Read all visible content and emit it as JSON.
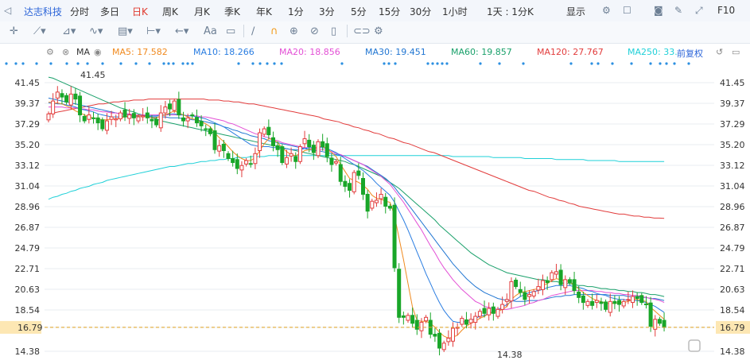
{
  "toolbar": {
    "stock_name": "达志科技",
    "periods": [
      "分时",
      "多日",
      "日K",
      "周K",
      "月K",
      "季K",
      "年K",
      "1分",
      "3分",
      "5分",
      "15分",
      "30分",
      "1小时",
      "1天 : 1分K"
    ],
    "active_period": "日K",
    "display_label": "显示",
    "right_label": "F10"
  },
  "drawing_tools": {
    "text_tool": "Aa",
    "icons": [
      "crosshair-icon",
      "line-tool-icon",
      "channel-tool-icon",
      "wave-tool-icon",
      "fib-tool-icon",
      "measure-tool-icon",
      "undo-icon",
      "text-tool-icon",
      "comment-icon",
      "pen-icon",
      "magnet-icon",
      "lock-icon",
      "hide-icon",
      "delete-icon",
      "link-icon",
      "settings-icon"
    ]
  },
  "indicators": {
    "label": "MA",
    "ma5": "MA5: 17.582",
    "ma10": "MA10: 18.266",
    "ma20": "MA20: 18.856",
    "ma30": "MA30: 19.451",
    "ma60": "MA60: 19.857",
    "ma120": "MA120: 27.767",
    "ma250": "MA250: 33.",
    "adjust": "前复权",
    "colors": {
      "ma5": "#f08a1f",
      "ma10": "#2a7de1",
      "ma20": "#e34fd5",
      "ma30": "#2176d2",
      "ma60": "#19a06a",
      "ma120": "#e23c3c",
      "ma250": "#1fd0d8"
    }
  },
  "chart_data": {
    "type": "candlestick",
    "y_ticks": [
      "41.45",
      "39.37",
      "37.29",
      "35.20",
      "33.12",
      "31.04",
      "28.96",
      "26.87",
      "24.79",
      "22.71",
      "20.63",
      "18.54",
      "16.79",
      "14.38"
    ],
    "ylim": [
      14.38,
      41.45
    ],
    "current_price": "16.79",
    "high_label": "41.45",
    "low_label": "14.38",
    "up_color": "#e23c3c",
    "down_color": "#19a629",
    "closes": [
      38.3,
      39.6,
      40.5,
      40.0,
      39.5,
      40.3,
      39.8,
      38.2,
      37.6,
      38.2,
      37.9,
      37.4,
      36.8,
      37.6,
      38.0,
      37.8,
      38.4,
      38.0,
      38.2,
      37.9,
      38.0,
      38.1,
      37.9,
      37.6,
      37.2,
      38.4,
      39.0,
      38.8,
      39.6,
      38.2,
      37.6,
      37.9,
      38.1,
      37.4,
      37.1,
      36.8,
      36.3,
      34.7,
      35.1,
      34.6,
      33.8,
      33.4,
      32.8,
      33.1,
      33.6,
      33.3,
      34.3,
      36.4,
      36.8,
      36.2,
      35.1,
      34.7,
      33.4,
      33.9,
      34.3,
      33.5,
      35.0,
      35.8,
      35.0,
      34.4,
      35.5,
      35.0,
      34.0,
      33.2,
      33.5,
      31.5,
      31.0,
      30.6,
      32.4,
      32.1,
      30.2,
      28.5,
      29.5,
      29.6,
      30.2,
      29.0,
      28.8,
      22.8,
      17.8,
      17.8,
      18.0,
      17.2,
      16.6,
      17.3,
      17.8,
      16.1,
      15.9,
      14.7,
      15.2,
      15.7,
      16.7,
      16.8,
      17.7,
      17.1,
      17.6,
      17.9,
      18.4,
      18.2,
      18.7,
      18.2,
      18.6,
      19.1,
      19.6,
      21.4,
      20.9,
      20.3,
      19.6,
      20.1,
      20.4,
      20.9,
      21.5,
      21.3,
      22.3,
      22.4,
      21.1,
      21.6,
      21.3,
      20.5,
      19.8,
      19.3,
      19.4,
      19.0,
      19.5,
      19.2,
      18.6,
      19.4,
      19.2,
      19.1,
      19.4,
      19.6,
      19.9,
      19.7,
      19.3,
      19.1,
      16.9,
      17.6,
      17.2,
      16.79
    ],
    "ma5": [
      39.5,
      39.4,
      39.4,
      39.3,
      39.1,
      38.9,
      38.6,
      38.4,
      38.2,
      38.0,
      37.9,
      37.8,
      37.7,
      37.7,
      37.8,
      37.8,
      37.9,
      38.0,
      38.1,
      38.1,
      38.1,
      38.1,
      38.0,
      37.9,
      37.9,
      38.1,
      38.2,
      38.4,
      38.6,
      38.4,
      38.2,
      38.0,
      37.8,
      37.7,
      37.5,
      37.3,
      37.0,
      36.4,
      35.9,
      35.5,
      35.0,
      34.5,
      34.1,
      33.8,
      33.6,
      33.6,
      33.9,
      34.6,
      35.3,
      35.8,
      35.7,
      35.4,
      34.9,
      34.5,
      34.2,
      34.1,
      34.3,
      34.6,
      34.7,
      34.8,
      35.0,
      35.0,
      34.8,
      34.4,
      34.0,
      33.2,
      32.5,
      31.8,
      31.6,
      31.4,
      31.1,
      30.7,
      30.1,
      29.8,
      29.7,
      29.5,
      29.4,
      28.0,
      25.8,
      23.6,
      21.2,
      18.8,
      17.5,
      17.4,
      17.4,
      17.2,
      16.8,
      16.3,
      15.9,
      15.7,
      15.8,
      16.0,
      16.5,
      16.9,
      17.2,
      17.4,
      17.7,
      17.9,
      18.2,
      18.3,
      18.4,
      18.6,
      18.9,
      19.6,
      20.0,
      20.3,
      20.4,
      20.5,
      20.6,
      20.7,
      21.0,
      21.2,
      21.5,
      21.7,
      21.6,
      21.5,
      21.4,
      21.0,
      20.7,
      20.3,
      20.0,
      19.7,
      19.5,
      19.4,
      19.2,
      19.2,
      19.2,
      19.3,
      19.3,
      19.4,
      19.6,
      19.6,
      19.5,
      19.4,
      18.8,
      18.4,
      18.0,
      17.6
    ],
    "ma10": [
      39.4,
      39.4,
      39.3,
      39.3,
      39.2,
      39.1,
      39.0,
      38.8,
      38.7,
      38.6,
      38.5,
      38.3,
      38.2,
      38.1,
      38.0,
      38.0,
      38.0,
      38.0,
      38.0,
      38.0,
      38.1,
      38.1,
      38.1,
      38.1,
      38.1,
      38.2,
      38.2,
      38.3,
      38.3,
      38.2,
      38.2,
      38.1,
      38.1,
      38.0,
      37.9,
      37.8,
      37.6,
      37.4,
      37.2,
      37.0,
      36.7,
      36.4,
      36.1,
      35.8,
      35.5,
      35.2,
      35.1,
      35.0,
      35.0,
      35.0,
      34.9,
      34.9,
      34.8,
      34.8,
      34.7,
      34.7,
      34.7,
      34.8,
      34.9,
      34.9,
      34.9,
      34.9,
      34.8,
      34.6,
      34.4,
      34.1,
      33.8,
      33.5,
      33.2,
      32.9,
      32.6,
      32.2,
      31.8,
      31.3,
      30.9,
      30.5,
      30.1,
      29.4,
      28.5,
      27.6,
      26.6,
      25.5,
      24.4,
      23.3,
      22.2,
      21.2,
      20.2,
      19.3,
      18.5,
      17.9,
      17.4,
      17.3,
      17.3,
      17.4,
      17.5,
      17.7,
      17.9,
      18.0,
      18.2,
      18.4,
      18.6,
      18.8,
      19.1,
      19.4,
      19.6,
      19.9,
      20.1,
      20.3,
      20.4,
      20.5,
      20.6,
      20.8,
      20.9,
      21.0,
      21.0,
      21.0,
      21.0,
      20.9,
      20.8,
      20.7,
      20.5,
      20.4,
      20.2,
      20.1,
      20.0,
      19.8,
      19.7,
      19.6,
      19.6,
      19.5,
      19.5,
      19.5,
      19.4,
      19.3,
      19.1,
      18.9,
      18.6,
      18.3
    ],
    "ma20": [
      39.0,
      39.0,
      39.0,
      39.0,
      38.9,
      38.9,
      38.9,
      38.8,
      38.8,
      38.7,
      38.7,
      38.6,
      38.5,
      38.5,
      38.4,
      38.4,
      38.3,
      38.3,
      38.3,
      38.2,
      38.2,
      38.2,
      38.2,
      38.2,
      38.2,
      38.2,
      38.2,
      38.2,
      38.2,
      38.2,
      38.2,
      38.1,
      38.1,
      38.1,
      38.0,
      38.0,
      37.9,
      37.8,
      37.7,
      37.6,
      37.4,
      37.3,
      37.1,
      36.9,
      36.7,
      36.5,
      36.3,
      36.2,
      36.0,
      35.9,
      35.7,
      35.6,
      35.4,
      35.3,
      35.2,
      35.1,
      35.0,
      34.9,
      34.9,
      34.8,
      34.7,
      34.7,
      34.6,
      34.5,
      34.3,
      34.2,
      34.0,
      33.8,
      33.6,
      33.4,
      33.2,
      32.9,
      32.6,
      32.3,
      32.0,
      31.6,
      31.2,
      30.6,
      30.0,
      29.4,
      28.7,
      28.0,
      27.3,
      26.6,
      25.8,
      25.0,
      24.3,
      23.5,
      22.8,
      22.2,
      21.6,
      21.1,
      20.6,
      20.2,
      19.8,
      19.4,
      19.2,
      18.9,
      18.8,
      18.7,
      18.6,
      18.6,
      18.6,
      18.7,
      18.8,
      18.9,
      19.0,
      19.2,
      19.3,
      19.5,
      19.6,
      19.8,
      20.0,
      20.1,
      20.2,
      20.3,
      20.4,
      20.5,
      20.5,
      20.5,
      20.5,
      20.5,
      20.4,
      20.4,
      20.3,
      20.3,
      20.2,
      20.2,
      20.1,
      20.1,
      20.0,
      20.0,
      19.9,
      19.8,
      19.7,
      19.6,
      19.5,
      19.3
    ],
    "ma30": [
      39.9,
      39.8,
      39.7,
      39.6,
      39.5,
      39.4,
      39.3,
      39.2,
      39.1,
      39.0,
      38.9,
      38.8,
      38.7,
      38.6,
      38.5,
      38.4,
      38.3,
      38.3,
      38.2,
      38.2,
      38.1,
      38.1,
      38.1,
      38.0,
      38.0,
      38.0,
      38.0,
      37.9,
      37.9,
      37.9,
      37.8,
      37.8,
      37.7,
      37.7,
      37.6,
      37.5,
      37.4,
      37.3,
      37.2,
      37.0,
      36.9,
      36.7,
      36.6,
      36.4,
      36.3,
      36.1,
      36.0,
      35.9,
      35.8,
      35.6,
      35.5,
      35.4,
      35.3,
      35.2,
      35.1,
      35.0,
      34.9,
      34.8,
      34.7,
      34.6,
      34.6,
      34.5,
      34.4,
      34.3,
      34.2,
      34.1,
      34.0,
      33.8,
      33.6,
      33.4,
      33.2,
      33.0,
      32.7,
      32.4,
      32.1,
      31.8,
      31.4,
      30.9,
      30.3,
      29.8,
      29.2,
      28.6,
      28.0,
      27.4,
      26.8,
      26.2,
      25.6,
      25.0,
      24.4,
      23.8,
      23.2,
      22.7,
      22.2,
      21.7,
      21.3,
      20.9,
      20.6,
      20.3,
      20.1,
      19.9,
      19.7,
      19.6,
      19.5,
      19.5,
      19.4,
      19.4,
      19.4,
      19.5,
      19.5,
      19.5,
      19.6,
      19.7,
      19.8,
      19.9,
      19.9,
      20.0,
      20.0,
      20.1,
      20.1,
      20.1,
      20.1,
      20.1,
      20.1,
      20.1,
      20.1,
      20.0,
      20.0,
      20.0,
      20.0,
      19.9,
      19.9,
      19.9,
      19.8,
      19.8,
      19.7,
      19.7,
      19.6,
      19.5,
      19.5,
      19.45
    ],
    "ma60": [
      42.0,
      41.9,
      41.7,
      41.5,
      41.3,
      41.1,
      40.9,
      40.7,
      40.5,
      40.3,
      40.1,
      39.9,
      39.7,
      39.5,
      39.3,
      39.1,
      38.9,
      38.8,
      38.6,
      38.5,
      38.3,
      38.2,
      38.0,
      37.9,
      37.8,
      37.6,
      37.5,
      37.4,
      37.3,
      37.2,
      37.1,
      37.0,
      36.9,
      36.8,
      36.7,
      36.6,
      36.5,
      36.4,
      36.3,
      36.2,
      36.1,
      36.0,
      35.9,
      35.8,
      35.7,
      35.6,
      35.5,
      35.4,
      35.3,
      35.2,
      35.1,
      35.0,
      34.9,
      34.8,
      34.7,
      34.6,
      34.5,
      34.4,
      34.3,
      34.2,
      34.1,
      34.0,
      33.9,
      33.8,
      33.7,
      33.6,
      33.5,
      33.3,
      33.2,
      33.0,
      32.8,
      32.6,
      32.4,
      32.2,
      32.0,
      31.7,
      31.4,
      31.1,
      30.8,
      30.4,
      30.0,
      29.6,
      29.2,
      28.8,
      28.4,
      28.0,
      27.6,
      27.1,
      26.7,
      26.3,
      25.9,
      25.5,
      25.1,
      24.7,
      24.3,
      24.0,
      23.7,
      23.4,
      23.1,
      22.9,
      22.7,
      22.5,
      22.3,
      22.2,
      22.1,
      22.0,
      21.9,
      21.8,
      21.7,
      21.6,
      21.6,
      21.5,
      21.4,
      21.4,
      21.3,
      21.2,
      21.2,
      21.1,
      21.0,
      21.0,
      20.9,
      20.9,
      20.8,
      20.7,
      20.7,
      20.6,
      20.6,
      20.5,
      20.5,
      20.4,
      20.4,
      20.3,
      20.3,
      20.2,
      20.1,
      20.1,
      20.0,
      19.9,
      19.9,
      19.86
    ],
    "ma120": [
      38.3,
      38.4,
      38.5,
      38.6,
      38.7,
      38.8,
      38.9,
      39.0,
      39.1,
      39.2,
      39.3,
      39.3,
      39.4,
      39.5,
      39.5,
      39.6,
      39.6,
      39.7,
      39.7,
      39.7,
      39.8,
      39.8,
      39.8,
      39.8,
      39.8,
      39.8,
      39.8,
      39.8,
      39.8,
      39.8,
      39.8,
      39.8,
      39.7,
      39.7,
      39.7,
      39.6,
      39.6,
      39.5,
      39.5,
      39.4,
      39.3,
      39.3,
      39.2,
      39.1,
      39.0,
      38.9,
      38.8,
      38.7,
      38.6,
      38.5,
      38.4,
      38.3,
      38.2,
      38.1,
      38.0,
      37.8,
      37.7,
      37.6,
      37.5,
      37.3,
      37.2,
      37.0,
      36.9,
      36.7,
      36.6,
      36.4,
      36.3,
      36.1,
      35.9,
      35.8,
      35.6,
      35.4,
      35.3,
      35.1,
      34.9,
      34.7,
      34.5,
      34.4,
      34.2,
      34.0,
      33.8,
      33.6,
      33.4,
      33.2,
      33.0,
      32.8,
      32.6,
      32.4,
      32.2,
      32.0,
      31.8,
      31.6,
      31.4,
      31.2,
      31.0,
      30.8,
      30.6,
      30.5,
      30.3,
      30.1,
      29.9,
      29.8,
      29.6,
      29.5,
      29.3,
      29.2,
      29.0,
      28.9,
      28.8,
      28.7,
      28.6,
      28.5,
      28.4,
      28.3,
      28.2,
      28.2,
      28.1,
      28.0,
      28.0,
      27.9,
      27.9,
      27.8,
      27.8,
      27.77
    ],
    "ma250": [
      29.7,
      29.9,
      30.0,
      30.2,
      30.3,
      30.5,
      30.6,
      30.8,
      30.9,
      31.0,
      31.2,
      31.3,
      31.4,
      31.6,
      31.7,
      31.8,
      31.9,
      32.0,
      32.1,
      32.2,
      32.3,
      32.4,
      32.5,
      32.6,
      32.7,
      32.8,
      32.9,
      33.0,
      33.0,
      33.1,
      33.2,
      33.3,
      33.3,
      33.4,
      33.5,
      33.5,
      33.6,
      33.6,
      33.7,
      33.7,
      33.8,
      33.8,
      33.9,
      33.9,
      33.9,
      34.0,
      34.0,
      34.0,
      34.0,
      34.1,
      34.1,
      34.1,
      34.1,
      34.1,
      34.1,
      34.1,
      34.1,
      34.1,
      34.1,
      34.1,
      34.1,
      34.1,
      34.1,
      34.1,
      34.1,
      34.1,
      34.1,
      34.1,
      34.1,
      34.1,
      34.1,
      34.1,
      34.1,
      34.1,
      34.1,
      34.1,
      34.1,
      34.1,
      34.1,
      34.1,
      34.1,
      34.1,
      34.1,
      34.1,
      34.1,
      34.1,
      34.1,
      34.1,
      34.1,
      34.1,
      34.0,
      34.0,
      34.0,
      34.0,
      34.0,
      34.0,
      34.0,
      34.0,
      34.0,
      33.9,
      33.9,
      33.9,
      33.9,
      33.9,
      33.9,
      33.9,
      33.8,
      33.8,
      33.8,
      33.8,
      33.8,
      33.8,
      33.8,
      33.7,
      33.7,
      33.7,
      33.7,
      33.7,
      33.7,
      33.7,
      33.6,
      33.6,
      33.6,
      33.6,
      33.6,
      33.6,
      33.6,
      33.5,
      33.5,
      33.5,
      33.5,
      33.5,
      33.5,
      33.5,
      33.5,
      33.5,
      33.5,
      33.5,
      33.5,
      33.5,
      33.5,
      33.5
    ],
    "event_marker_color": "#2b8fe0"
  }
}
